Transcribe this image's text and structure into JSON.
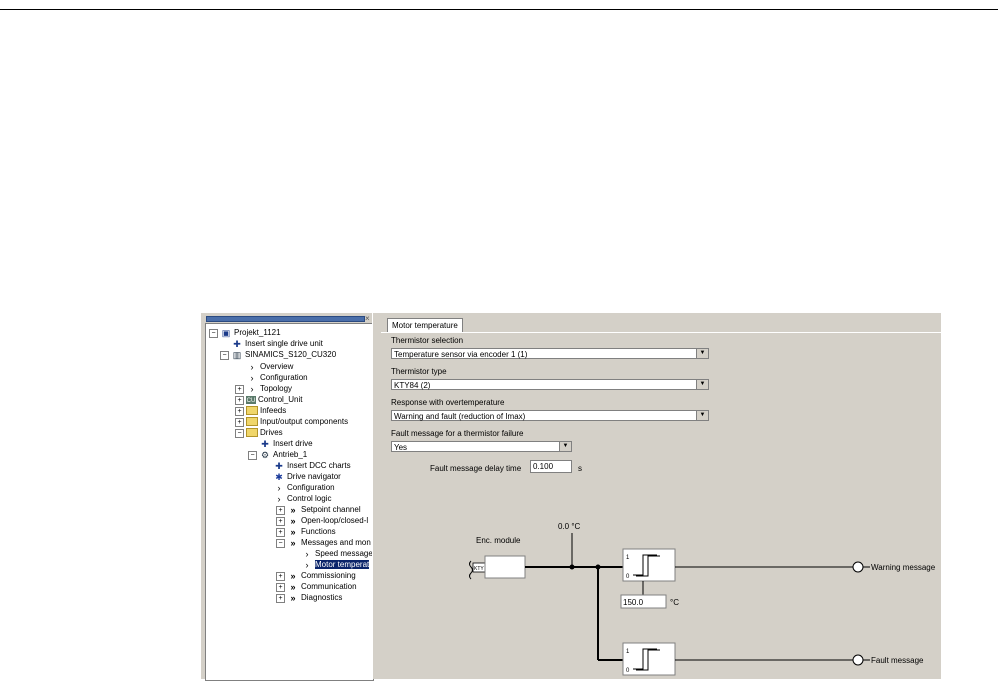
{
  "tree": {
    "items": [
      {
        "label": "Projekt_1121",
        "icon": "project-icon"
      },
      {
        "label": "Insert single drive unit",
        "icon": "insert-icon"
      },
      {
        "label": "SINAMICS_S120_CU320",
        "icon": "drive-unit-icon"
      },
      {
        "label": "Overview",
        "icon": "arrow-icon"
      },
      {
        "label": "Configuration",
        "icon": "arrow-icon"
      },
      {
        "label": "Topology",
        "icon": "arrow-icon"
      },
      {
        "label": "Control_Unit",
        "icon": "control-unit-icon"
      },
      {
        "label": "Infeeds",
        "icon": "folder-icon"
      },
      {
        "label": "Input/output components",
        "icon": "folder-icon"
      },
      {
        "label": "Drives",
        "icon": "folder-icon"
      },
      {
        "label": "Insert drive",
        "icon": "insert-icon"
      },
      {
        "label": "Antrieb_1",
        "icon": "drive-icon"
      },
      {
        "label": "Insert DCC charts",
        "icon": "insert-icon"
      },
      {
        "label": "Drive navigator",
        "icon": "navigator-icon"
      },
      {
        "label": "Configuration",
        "icon": "arrow-icon"
      },
      {
        "label": "Control logic",
        "icon": "arrow-icon"
      },
      {
        "label": "Setpoint channel",
        "icon": "double-arrow-icon"
      },
      {
        "label": "Open-loop/closed-l",
        "icon": "double-arrow-icon"
      },
      {
        "label": "Functions",
        "icon": "double-arrow-icon"
      },
      {
        "label": "Messages and mon",
        "icon": "double-arrow-icon"
      },
      {
        "label": "Speed message",
        "icon": "arrow-icon"
      },
      {
        "label": "Motor temperat",
        "icon": "arrow-icon"
      },
      {
        "label": "Commissioning",
        "icon": "double-arrow-icon"
      },
      {
        "label": "Communication",
        "icon": "double-arrow-icon"
      },
      {
        "label": "Diagnostics",
        "icon": "double-arrow-icon"
      }
    ],
    "close_glyph": "×"
  },
  "main": {
    "tab": "Motor temperature",
    "thermistor_selection": {
      "label": "Thermistor selection",
      "value": "Temperature sensor via encoder 1 (1)"
    },
    "thermistor_type": {
      "label": "Thermistor type",
      "value": "KTY84 (2)"
    },
    "response": {
      "label": "Response with overtemperature",
      "value": "Warning and fault (reduction of Imax)"
    },
    "fault_failure": {
      "label": "Fault message for a thermistor failure",
      "value": "Yes"
    },
    "delay": {
      "label": "Fault message delay time",
      "value": "0.100",
      "unit": "s"
    }
  },
  "diagram": {
    "temp_value": "0.0 °C",
    "enc_label": "Enc. module",
    "kty_label": "KTY",
    "threshold_value": "150.0",
    "threshold_unit": "°C",
    "one_label": "1",
    "zero_label": "0",
    "warning_label": "Warning message",
    "fault_label": "Fault message"
  },
  "colors": {
    "panel": "#d4d0c8",
    "selection": "#0a246a",
    "titlebar": "#4a6ea9"
  }
}
